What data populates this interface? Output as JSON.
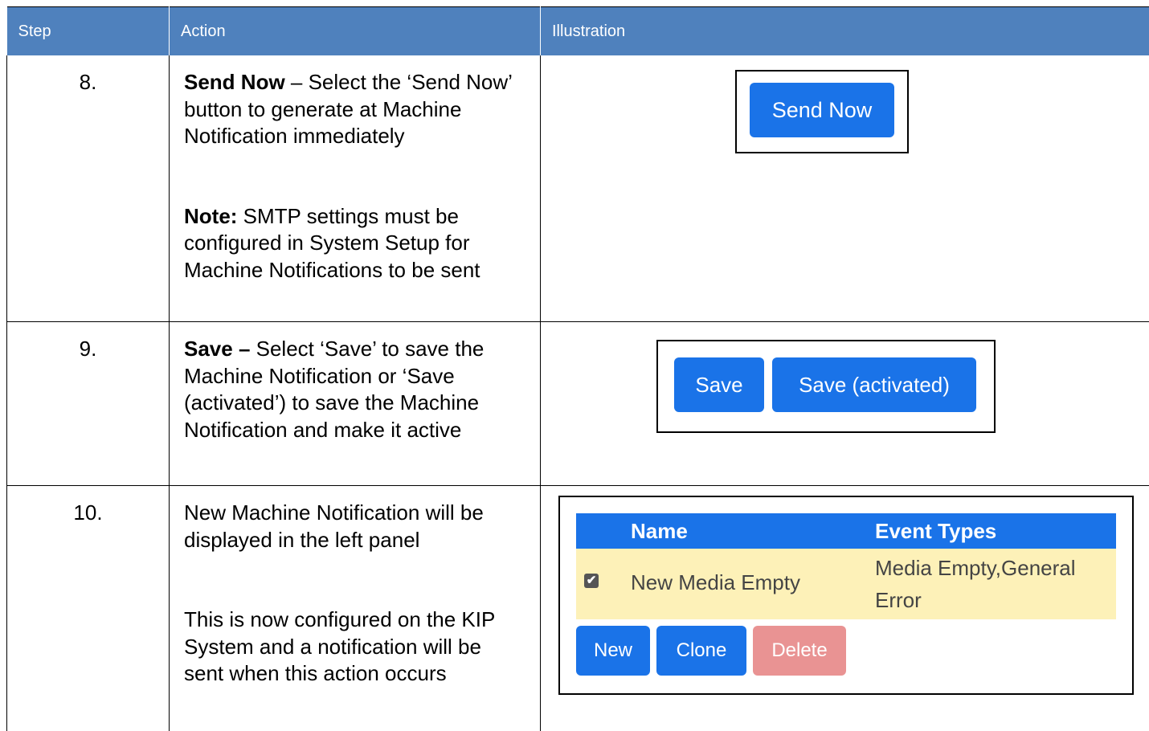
{
  "table": {
    "headers": {
      "step": "Step",
      "action": "Action",
      "illustration": "Illustration"
    }
  },
  "rows": [
    {
      "step": "8.",
      "bold1": "Send Now",
      "text1": " – Select the ‘Send Now’ button to generate at Machine Notification immediately",
      "bold2": "Note:",
      "text2": " SMTP settings must be configured in System Setup for Machine Notifications to be sent",
      "illustration": {
        "send_now_button": "Send Now"
      }
    },
    {
      "step": "9.",
      "bold1": "Save –",
      "text1": " Select ‘Save’ to save the Machine Notification or ‘Save (activated’) to save the Machine Notification and make it active",
      "illustration": {
        "save_button": "Save",
        "save_activated_button": "Save (activated)"
      }
    },
    {
      "step": "10.",
      "text1": "New Machine Notification will be displayed in the left panel",
      "text2": "This is now configured on the KIP System and a notification will be sent when this action occurs",
      "illustration": {
        "col_name": "Name",
        "col_event_types": "Event Types",
        "row_name": "New Media Empty",
        "row_event_types": "Media Empty,General Error",
        "checkbox_mark": "✔",
        "new_button": "New",
        "clone_button": "Clone",
        "delete_button": "Delete",
        "delete_color": "#e99393"
      }
    }
  ]
}
